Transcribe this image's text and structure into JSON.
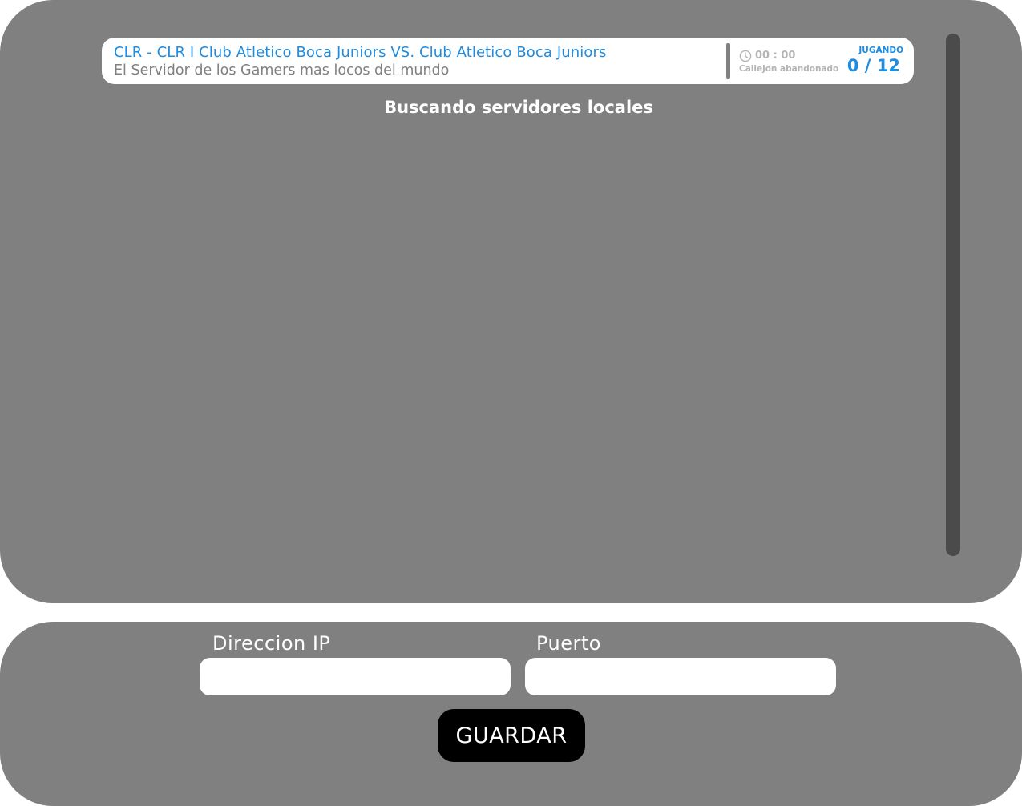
{
  "server_list": {
    "servers": [
      {
        "name": "CLR - CLR  I Club Atletico Boca Juniors VS. Club Atletico Boca Juniors",
        "description": "El Servidor de los Gamers mas locos del mundo",
        "time": "00 : 00",
        "map": "Callejon abandonado",
        "status": "JUGANDO",
        "players": "0 / 12"
      }
    ],
    "status_message": "Buscando servidores locales"
  },
  "connect_form": {
    "ip_label": "Direccion IP",
    "ip_value": "",
    "port_label": "Puerto",
    "port_value": "",
    "save_label": "GUARDAR"
  },
  "colors": {
    "panel": "#808080",
    "accent": "#1e8ce0",
    "muted": "#b4b4b4",
    "scrollbar": "#4b4b4b",
    "button": "#000000"
  },
  "icons": {
    "time": "clock-icon"
  }
}
